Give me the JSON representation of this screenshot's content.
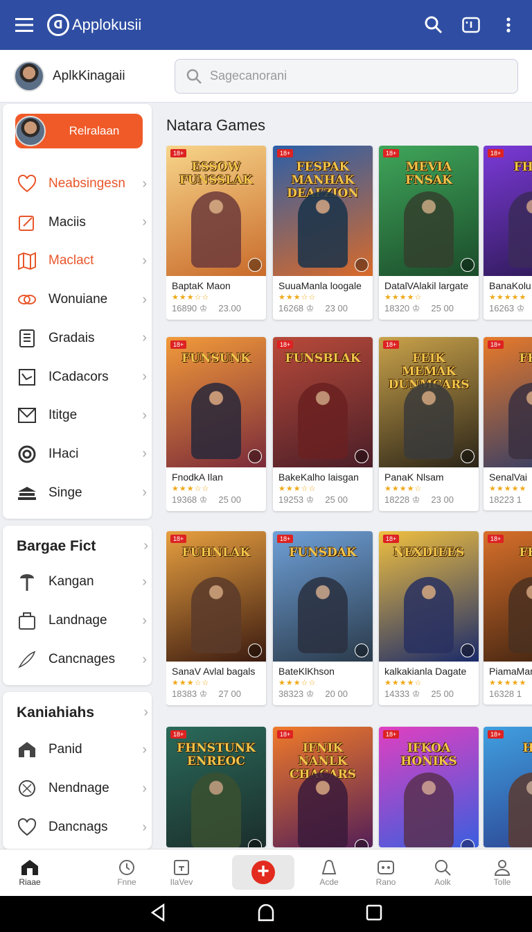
{
  "app": {
    "title": "Applokusii"
  },
  "profile": {
    "name": "AplkKinagaii"
  },
  "search": {
    "placeholder": "Sagecanorani"
  },
  "sidebar": {
    "primary_button": "Relralaan",
    "items": [
      {
        "label": "Neabsingesn",
        "icon": "heart-icon",
        "active": true
      },
      {
        "label": "Maciis",
        "icon": "edit-icon",
        "active": false
      },
      {
        "label": "Maclact",
        "icon": "map-icon",
        "active": true
      },
      {
        "label": "Wonuiane",
        "icon": "link-icon",
        "active": false
      },
      {
        "label": "Gradais",
        "icon": "book-icon",
        "active": false
      },
      {
        "label": "ICadacors",
        "icon": "chart-icon",
        "active": false
      },
      {
        "label": "Ititge",
        "icon": "mail-icon",
        "active": false
      },
      {
        "label": "IHaci",
        "icon": "target-icon",
        "active": false
      },
      {
        "label": "Singe",
        "icon": "stack-icon",
        "active": false
      }
    ]
  },
  "section2": {
    "title": "Bargae Fict",
    "items": [
      {
        "label": "Kangan",
        "icon": "pin-icon"
      },
      {
        "label": "Landnage",
        "icon": "bag-icon"
      },
      {
        "label": "Cancnages",
        "icon": "feather-icon"
      }
    ]
  },
  "section3": {
    "title": "Kaniahiahs",
    "items": [
      {
        "label": "Panid",
        "icon": "home-icon"
      },
      {
        "label": "Nendnage",
        "icon": "compass-icon"
      },
      {
        "label": "Dancnags",
        "icon": "heart-icon"
      }
    ]
  },
  "main": {
    "title": "Natara Games",
    "games": [
      {
        "art_title": "ESSOW FUNSSLAK",
        "name": "BaptaK Maon",
        "stars": "★★★☆☆",
        "count": "16890 ♔",
        "price": "23.00",
        "colors": [
          "#f7d58a",
          "#c96a2a"
        ],
        "hero": "#6d3a3a"
      },
      {
        "art_title": "FESPAK MANHAK DEAFZION",
        "name": "SuuaManla loogale",
        "stars": "★★★☆☆",
        "count": "16268 ♔",
        "price": "23 00",
        "colors": [
          "#2c5fa8",
          "#d86a2a"
        ],
        "hero": "#18324a"
      },
      {
        "art_title": "MEVIA FNSAK",
        "name": "DatalVAlakil largate",
        "stars": "★★★★☆",
        "count": "18320 ♔",
        "price": "25 00",
        "colors": [
          "#3fa65a",
          "#1b4b2a"
        ],
        "hero": "#33402d"
      },
      {
        "art_title": "FHAN",
        "name": "BanaKolu",
        "stars": "★★★★★",
        "count": "16263 ♔",
        "price": "",
        "colors": [
          "#7b3ad8",
          "#2a1850"
        ],
        "hero": "#3b2a5a"
      },
      {
        "art_title": "FUNSUNK",
        "name": "FnodkA Ilan",
        "stars": "★★★☆☆",
        "count": "19368 ♔",
        "price": "25 00",
        "colors": [
          "#f29a3a",
          "#7a2a3a"
        ],
        "hero": "#28283a"
      },
      {
        "art_title": "FUNSBLAK",
        "name": "BakeKalho laisgan",
        "stars": "★★★☆☆",
        "count": "19253 ♔",
        "price": "25 00",
        "colors": [
          "#b84a3a",
          "#4a1e28"
        ],
        "hero": "#6a2020"
      },
      {
        "art_title": "FEIK MEMAK DUNMCARS",
        "name": "PanaK Nlsam",
        "stars": "★★★★☆",
        "count": "18228 ♔",
        "price": "23 00",
        "colors": [
          "#c9a24a",
          "#2a2418"
        ],
        "hero": "#3a3a3a"
      },
      {
        "art_title": "FHA",
        "name": "SenalVai",
        "stars": "★★★★★",
        "count": "18223 1",
        "price": "",
        "colors": [
          "#e87a2a",
          "#2a3a6a"
        ],
        "hero": "#3a3040"
      },
      {
        "art_title": "FUHNLAK",
        "name": "SanaV Avlal bagals",
        "stars": "★★★☆☆",
        "count": "18383 ♔",
        "price": "27 00",
        "colors": [
          "#e8a040",
          "#3a1a10"
        ],
        "hero": "#5a3a2a"
      },
      {
        "art_title": "FUNSDAK",
        "name": "BateKlKhson",
        "stars": "★★★☆☆",
        "count": "38323 ♔",
        "price": "20 00",
        "colors": [
          "#6fa0d8",
          "#2a3a4a"
        ],
        "hero": "#2a3040"
      },
      {
        "art_title": "NEXDIEES",
        "name": "kalkakianla Dagate",
        "stars": "★★★★☆",
        "count": "14333 ♔",
        "price": "25 00",
        "colors": [
          "#f0c040",
          "#1a2a6a"
        ],
        "hero": "#283060"
      },
      {
        "art_title": "FHA",
        "name": "PiamaMar",
        "stars": "★★★★★",
        "count": "16328 1",
        "price": "",
        "colors": [
          "#d8702a",
          "#3a2010"
        ],
        "hero": "#4a3020"
      },
      {
        "art_title": "FHNSTUNK ENREOC",
        "name": "",
        "stars": "",
        "count": "",
        "price": "",
        "colors": [
          "#2a6a5a",
          "#1a2a28"
        ],
        "hero": "#3a5030"
      },
      {
        "art_title": "IFNIK NANLK CHACARS",
        "name": "",
        "stars": "",
        "count": "",
        "price": "",
        "colors": [
          "#f07a2a",
          "#4a1a5a"
        ],
        "hero": "#3a1a3a"
      },
      {
        "art_title": "IFKOA HONIKS",
        "name": "",
        "stars": "",
        "count": "",
        "price": "",
        "colors": [
          "#e040c0",
          "#3060e0"
        ],
        "hero": "#5a3050"
      },
      {
        "art_title": "HO",
        "name": "",
        "stars": "",
        "count": "",
        "price": "",
        "colors": [
          "#40a0e0",
          "#2a3a8a"
        ],
        "hero": "#5a3a30"
      }
    ]
  },
  "bottom_nav": [
    {
      "label": "Riaae",
      "icon": "home-icon"
    },
    {
      "label": "Fnne",
      "icon": "clock-icon"
    },
    {
      "label": "IlaVev",
      "icon": "calendar-icon"
    },
    {
      "label": "",
      "icon": "add-icon"
    },
    {
      "label": "Acde",
      "icon": "bell-icon"
    },
    {
      "label": "Rano",
      "icon": "gamepad-icon"
    },
    {
      "label": "Aolk",
      "icon": "search-icon"
    },
    {
      "label": "Tolle",
      "icon": "user-icon"
    }
  ]
}
